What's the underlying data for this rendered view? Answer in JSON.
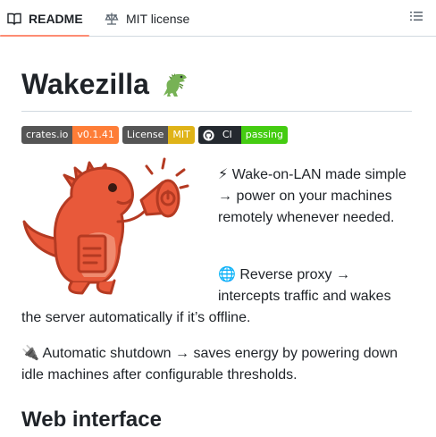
{
  "tabs": {
    "readme": "README",
    "license": "MIT license"
  },
  "readme": {
    "title": "Wakezilla",
    "title_emoji": "🦖",
    "badges": [
      {
        "left": "crates.io",
        "right": "v0.1.41",
        "right_color": "#fe7d37"
      },
      {
        "left": "License",
        "right": "MIT",
        "right_color": "#dfb317"
      },
      {
        "left": "CI",
        "right": "passing",
        "right_color": "#44cc11"
      }
    ],
    "features": {
      "wol_emoji": "⚡",
      "wol_text": "Wake-on-LAN made simple → power on your machines remotely whenever needed.",
      "proxy_emoji": "🌐",
      "proxy_text_a": "Reverse proxy →",
      "proxy_text_a2": "intercepts traffic and wakes",
      "proxy_text_b": "the server automatically if it’s offline.",
      "shutdown_emoji": "🔌",
      "shutdown_text": "Automatic shutdown → saves energy by powering down idle machines after configurable thresholds."
    },
    "section_heading": "Web interface"
  },
  "colors": {
    "tab_underline": "#fd8c73",
    "mascot": "#e8593a",
    "text": "#1f2328"
  }
}
